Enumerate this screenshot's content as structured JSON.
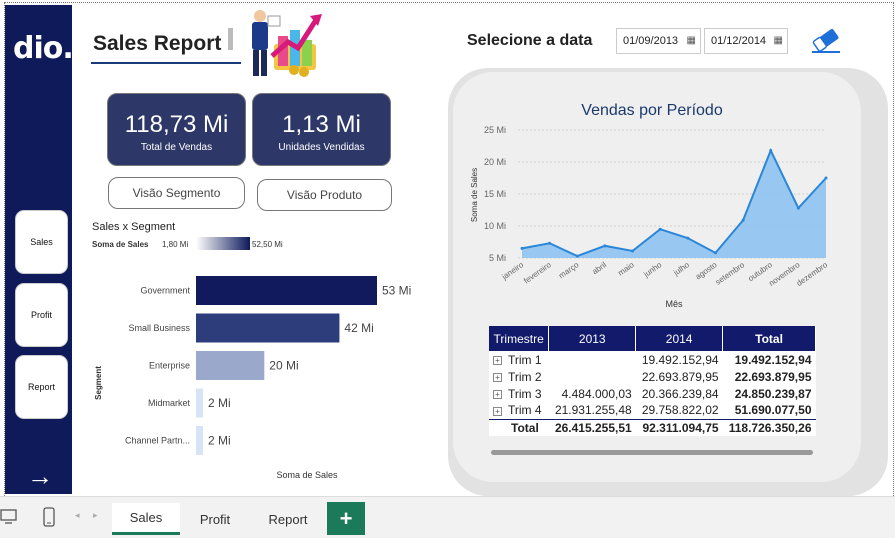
{
  "brand": {
    "logo_text": "dio."
  },
  "nav": {
    "items": [
      {
        "label": "Sales"
      },
      {
        "label": "Profit"
      },
      {
        "label": "Report"
      }
    ],
    "arrow": "→"
  },
  "header": {
    "title": "Sales Report"
  },
  "kpis": [
    {
      "value": "118,73 Mi",
      "label": "Total de Vendas"
    },
    {
      "value": "1,13 Mi",
      "label": "Unidades Vendidas"
    }
  ],
  "buttons": {
    "segmento": "Visão Segmento",
    "produto": "Visão Produto"
  },
  "date_filter": {
    "title": "Selecione a data",
    "start": "01/09/2013",
    "end": "01/12/2014",
    "calendar_icon": "calendar-icon",
    "eraser_icon": "eraser-icon"
  },
  "segment_chart": {
    "title": "Sales x Segment",
    "legend_label": "Soma de Sales",
    "legend_min": "1,80 Mi",
    "legend_max": "52,50 Mi",
    "ylabel": "Segment",
    "xlabel": "Soma de Sales"
  },
  "period_chart": {
    "title": "Vendas por Período",
    "ylabel": "Soma de Sales",
    "xlabel": "Mês"
  },
  "table": {
    "headers": [
      "Trimestre",
      "2013",
      "2014",
      "Total"
    ],
    "rows": [
      {
        "label": "Trim 1",
        "y2013": "",
        "y2014": "19.492.152,94",
        "total": "19.492.152,94"
      },
      {
        "label": "Trim 2",
        "y2013": "",
        "y2014": "22.693.879,95",
        "total": "22.693.879,95"
      },
      {
        "label": "Trim 3",
        "y2013": "4.484.000,03",
        "y2014": "20.366.239,84",
        "total": "24.850.239,87"
      },
      {
        "label": "Trim 4",
        "y2013": "21.931.255,48",
        "y2014": "29.758.822,02",
        "total": "51.690.077,50"
      }
    ],
    "total_row": {
      "label": "Total",
      "y2013": "26.415.255,51",
      "y2014": "92.311.094,75",
      "total": "118.726.350,26"
    }
  },
  "tabs": {
    "items": [
      {
        "label": "Sales"
      },
      {
        "label": "Profit"
      },
      {
        "label": "Report"
      }
    ],
    "add": "+"
  },
  "colors": {
    "navy": "#0e1a5a",
    "accent_green": "#1b7a5a",
    "area_fill": "#8ec3f2",
    "area_line": "#2b86d8"
  },
  "chart_data": [
    {
      "type": "bar",
      "title": "Sales x Segment",
      "xlabel": "Soma de Sales",
      "ylabel": "Segment",
      "categories": [
        "Government",
        "Small Business",
        "Enterprise",
        "Midmarket",
        "Channel Partn..."
      ],
      "values": [
        53,
        42,
        20,
        2,
        2
      ],
      "value_labels": [
        "53 Mi",
        "42 Mi",
        "20 Mi",
        "2 Mi",
        "2 Mi"
      ],
      "colors": [
        "#111a5c",
        "#2d3c7a",
        "#9aa8cc",
        "#d6e4f6",
        "#d6e4f6"
      ],
      "orientation": "horizontal",
      "xlim": [
        0,
        53
      ]
    },
    {
      "type": "area",
      "title": "Vendas por Período",
      "xlabel": "Mês",
      "ylabel": "Soma de Sales",
      "categories": [
        "janeiro",
        "fevereiro",
        "março",
        "abril",
        "maio",
        "junho",
        "julho",
        "agosto",
        "setembro",
        "outubro",
        "novembro",
        "dezembro"
      ],
      "values": [
        6.5,
        7.3,
        5.3,
        6.9,
        6.1,
        9.5,
        8.1,
        5.8,
        10.9,
        21.8,
        12.8,
        17.5
      ],
      "yticks": [
        "5 Mi",
        "10 Mi",
        "15 Mi",
        "20 Mi",
        "25 Mi"
      ],
      "ytick_values": [
        5,
        10,
        15,
        20,
        25
      ],
      "ylim": [
        5,
        25
      ]
    }
  ]
}
